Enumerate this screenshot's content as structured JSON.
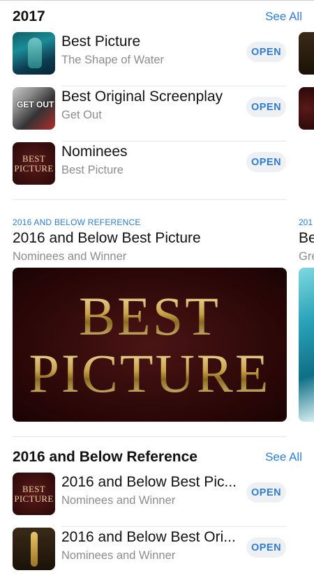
{
  "section_2017": {
    "title": "2017",
    "see_all": "See All",
    "items": [
      {
        "title": "Best Picture",
        "subtitle": "The Shape of Water",
        "button": "OPEN",
        "thumb_icon": "shape-of-water-poster"
      },
      {
        "title": "Best Original Screenplay",
        "subtitle": "Get Out",
        "button": "OPEN",
        "thumb_icon": "get-out-poster",
        "thumb_text": "GET OUT"
      },
      {
        "title": "Nominees",
        "subtitle": "Best Picture",
        "button": "OPEN",
        "thumb_icon": "best-picture-logo",
        "thumb_text": [
          "BEST",
          "PICTURE"
        ]
      }
    ]
  },
  "featured": {
    "caption": "2016 AND BELOW REFERENCE",
    "title": "2016 and Below Best Picture",
    "subtitle": "Nominees and Winner",
    "banner_text": [
      "BEST",
      "PICTURE"
    ]
  },
  "peek": {
    "caption": "201",
    "title": "Be",
    "subtitle": "Gre"
  },
  "section_reference": {
    "title": "2016 and Below Reference",
    "see_all": "See All",
    "items": [
      {
        "title": "2016 and Below Best Pic...",
        "subtitle": "Nominees and Winner",
        "button": "OPEN",
        "thumb_icon": "best-picture-logo",
        "thumb_text": [
          "BEST",
          "PICTURE"
        ]
      },
      {
        "title": "2016 and Below Best Ori...",
        "subtitle": "Nominees and Winner",
        "button": "OPEN",
        "thumb_icon": "oscars-statuette"
      }
    ]
  },
  "colors": {
    "accent": "#2d7dd2",
    "button_bg": "#eef0f3",
    "subtitle": "#8c8c8c"
  }
}
